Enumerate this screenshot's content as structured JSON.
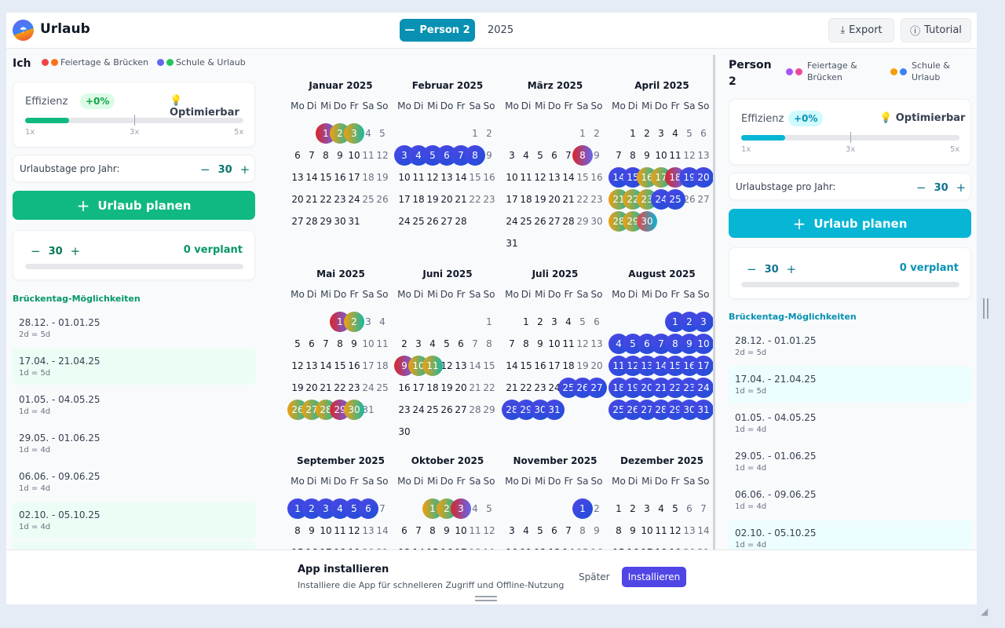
{
  "app": {
    "title": "Urlaub",
    "person_button": "Person 2",
    "person_button_icon": "minus-icon",
    "year": "2025",
    "export": "Export",
    "tutorial": "Tutorial"
  },
  "left": {
    "name": "Ich",
    "legend1": "Feiertage & Brücken",
    "legend2": "Schule & Urlaub",
    "legend_colors": [
      "#ef4444",
      "#f97316",
      "#6366f1",
      "#22c55e"
    ],
    "efficiency_label": "Effizienz",
    "efficiency_badge": "+0%",
    "optimizable": "Optimierbar",
    "efficiency_level": 0.2,
    "scale": [
      "1x",
      "3x",
      "5x"
    ],
    "days_label": "Urlaubstage pro Jahr:",
    "days_value": "30",
    "plan_button": "Urlaub planen",
    "budget_value": "30",
    "planned": "0 verplant",
    "section": "Brückentag-Möglichkeiten",
    "bridges": [
      {
        "range": "28.12. - 01.01.25",
        "sub": "2d = 5d"
      },
      {
        "range": "17.04. - 21.04.25",
        "sub": "1d = 5d"
      },
      {
        "range": "01.05. - 04.05.25",
        "sub": "1d = 4d"
      },
      {
        "range": "29.05. - 01.06.25",
        "sub": "1d = 4d"
      },
      {
        "range": "06.06. - 09.06.25",
        "sub": "1d = 4d"
      },
      {
        "range": "02.10. - 05.10.25",
        "sub": "1d = 4d"
      },
      {
        "range": "",
        "sub": ""
      }
    ]
  },
  "right": {
    "name": "Person 2",
    "legend1": "Feiertage & Brücken",
    "legend2": "Schule & Urlaub",
    "legend_colors": [
      "#a855f7",
      "#ec4899",
      "#f59e0b",
      "#3b82f6"
    ],
    "efficiency_label": "Effizienz",
    "efficiency_badge": "+0%",
    "optimizable": "Optimierbar",
    "efficiency_level": 0.2,
    "scale": [
      "1x",
      "3x",
      "5x"
    ],
    "days_label": "Urlaubstage pro Jahr:",
    "days_value": "30",
    "plan_button": "Urlaub planen",
    "budget_value": "30",
    "planned": "0 verplant",
    "section": "Brückentag-Möglichkeiten",
    "bridges": [
      {
        "range": "28.12. - 01.01.25",
        "sub": "2d = 5d"
      },
      {
        "range": "17.04. - 21.04.25",
        "sub": "1d = 5d"
      },
      {
        "range": "01.05. - 04.05.25",
        "sub": "1d = 4d"
      },
      {
        "range": "29.05. - 01.06.25",
        "sub": "1d = 4d"
      },
      {
        "range": "06.06. - 09.06.25",
        "sub": "1d = 4d"
      },
      {
        "range": "02.10. - 05.10.25",
        "sub": "1d = 4d"
      }
    ]
  },
  "weekdays": [
    "Mo",
    "Di",
    "Mi",
    "Do",
    "Fr",
    "Sa",
    "So"
  ],
  "months": [
    {
      "name": "Januar 2025",
      "offset": 2,
      "days": 31,
      "hi": {
        "1": "red",
        "2": "orange",
        "3": "orange"
      }
    },
    {
      "name": "Februar 2025",
      "offset": 5,
      "days": 28,
      "hi": {
        "3": "blue",
        "4": "blue",
        "5": "blue",
        "6": "blue",
        "7": "blue",
        "8": "blue"
      }
    },
    {
      "name": "März 2025",
      "offset": 5,
      "days": 31,
      "hi": {
        "8": "red"
      }
    },
    {
      "name": "April 2025",
      "offset": 1,
      "days": 30,
      "hi": {
        "14": "blue",
        "15": "blue",
        "16": "orange",
        "17": "orange",
        "18": "red",
        "19": "blue",
        "20": "blue",
        "21": "orange",
        "22": "orange",
        "23": "orange",
        "24": "blue",
        "25": "blue",
        "28": "orange",
        "29": "orange",
        "30": "tp"
      }
    },
    {
      "name": "Mai 2025",
      "offset": 3,
      "days": 31,
      "hi": {
        "1": "red",
        "2": "orange",
        "26": "orange",
        "27": "orange",
        "28": "orange",
        "29": "red",
        "30": "orange"
      }
    },
    {
      "name": "Juni 2025",
      "offset": 6,
      "days": 30,
      "hi": {
        "9": "red",
        "10": "orange",
        "11": "orange"
      }
    },
    {
      "name": "Juli 2025",
      "offset": 1,
      "days": 31,
      "hi": {
        "25": "blue",
        "26": "blue",
        "27": "blue",
        "28": "blue",
        "29": "blue",
        "30": "blue",
        "31": "blue"
      }
    },
    {
      "name": "August 2025",
      "offset": 4,
      "days": 31,
      "hi": {
        "1": "blue",
        "2": "blue",
        "3": "blue",
        "4": "blue",
        "5": "blue",
        "6": "blue",
        "7": "blue",
        "8": "blue",
        "9": "blue",
        "10": "blue",
        "11": "blue",
        "12": "blue",
        "13": "blue",
        "14": "blue",
        "15": "blue",
        "16": "blue",
        "17": "blue",
        "18": "blue",
        "19": "blue",
        "20": "blue",
        "21": "blue",
        "22": "blue",
        "23": "blue",
        "24": "blue",
        "25": "blue",
        "26": "blue",
        "27": "blue",
        "28": "blue",
        "29": "blue",
        "30": "blue",
        "31": "blue"
      }
    },
    {
      "name": "September 2025",
      "offset": 0,
      "days": 30,
      "hi": {
        "1": "blue",
        "2": "blue",
        "3": "blue",
        "4": "blue",
        "5": "blue",
        "6": "blue"
      }
    },
    {
      "name": "Oktober 2025",
      "offset": 2,
      "days": 31,
      "hi": {
        "1": "orange",
        "2": "orange",
        "3": "red"
      }
    },
    {
      "name": "November 2025",
      "offset": 5,
      "days": 30,
      "hi": {
        "1": "blue"
      }
    },
    {
      "name": "Dezember 2025",
      "offset": 0,
      "days": 31,
      "hi": {}
    }
  ],
  "install": {
    "title": "App installieren",
    "desc": "Installiere die App für schnelleren Zugriff und Offline-Nutzung",
    "later": "Später",
    "install": "Installieren"
  }
}
